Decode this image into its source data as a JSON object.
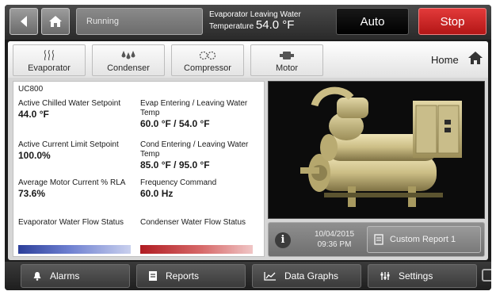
{
  "topbar": {
    "status": "Running",
    "evap_label_line1": "Evaporator Leaving Water",
    "evap_label_line2": "Temperature",
    "evap_value": "54.0 °F",
    "auto_label": "Auto",
    "stop_label": "Stop",
    "back_icon": "back-arrow-icon",
    "home_icon": "home-icon"
  },
  "tabs": [
    {
      "label": "Evaporator",
      "icon": "evaporator-icon"
    },
    {
      "label": "Condenser",
      "icon": "condenser-icon"
    },
    {
      "label": "Compressor",
      "icon": "compressor-icon"
    },
    {
      "label": "Motor",
      "icon": "motor-icon"
    }
  ],
  "home_link": "Home",
  "panel": {
    "title": "UC800",
    "cells": [
      {
        "label": "Active Chilled Water Setpoint",
        "value": "44.0 °F"
      },
      {
        "label": "Evap Entering / Leaving Water Temp",
        "value": "60.0 °F / 54.0 °F"
      },
      {
        "label": "Active Current Limit Setpoint",
        "value": "100.0%"
      },
      {
        "label": "Cond Entering / Leaving Water Temp",
        "value": "85.0 °F / 95.0 °F"
      },
      {
        "label": "Average Motor Current % RLA",
        "value": "73.6%"
      },
      {
        "label": "Frequency Command",
        "value": "60.0 Hz"
      },
      {
        "label": "Evaporator Water Flow Status",
        "value": ""
      },
      {
        "label": "Condenser Water Flow Status",
        "value": ""
      }
    ]
  },
  "infobar": {
    "date": "10/04/2015",
    "time": "09:36 PM",
    "report_label": "Custom Report 1",
    "info_icon": "i"
  },
  "nav": [
    {
      "label": "Alarms",
      "icon": "bell-icon"
    },
    {
      "label": "Reports",
      "icon": "report-icon"
    },
    {
      "label": "Data Graphs",
      "icon": "chart-icon"
    },
    {
      "label": "Settings",
      "icon": "sliders-icon"
    }
  ],
  "colors": {
    "stop": "#c62020",
    "evap_flow": "#2c3f9a",
    "cond_flow": "#b01c22"
  }
}
